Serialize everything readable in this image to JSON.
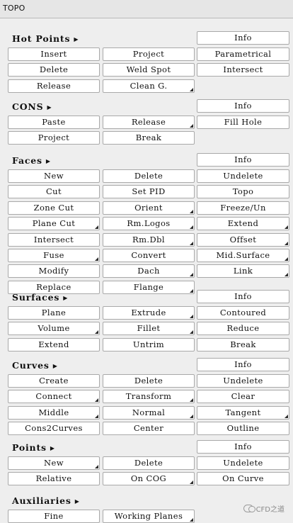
{
  "window": {
    "title": "TOPO"
  },
  "watermark": "CFD之道",
  "sections": [
    {
      "id": "hot-points",
      "title": "Hot Points",
      "info": "Info",
      "rows": [
        [
          "Insert",
          "Project",
          "Parametrical"
        ],
        [
          "Delete",
          "Weld Spot",
          "Intersect"
        ],
        [
          "Release",
          "Clean G."
        ]
      ],
      "corners": [
        "Clean G."
      ]
    },
    {
      "id": "cons",
      "title": "CONS",
      "info": "Info",
      "rows": [
        [
          "Paste",
          "Release",
          "Fill Hole"
        ],
        [
          "Project",
          "Break"
        ]
      ],
      "corners": [
        "Release"
      ]
    },
    {
      "id": "faces",
      "title": "Faces",
      "info": "Info",
      "rows": [
        [
          "New",
          "Delete",
          "Undelete"
        ],
        [
          "Cut",
          "Set PID",
          "Topo"
        ],
        [
          "Zone Cut",
          "Orient",
          "Freeze/Un"
        ],
        [
          "Plane Cut",
          "Rm.Logos",
          "Extend"
        ],
        [
          "Intersect",
          "Rm.Dbl",
          "Offset"
        ],
        [
          "Fuse",
          "Convert",
          "Mid.Surface"
        ],
        [
          "Modify",
          "Dach",
          "Link"
        ],
        [
          "Replace",
          "Flange"
        ]
      ],
      "corners": [
        "Orient",
        "Plane Cut",
        "Rm.Logos",
        "Extend",
        "Rm.Dbl",
        "Offset",
        "Fuse",
        "Mid.Surface",
        "Dach",
        "Link",
        "Flange"
      ]
    },
    {
      "id": "surfaces",
      "title": "Surfaces",
      "info": "Info",
      "rows": [
        [
          "Plane",
          "Extrude",
          "Contoured"
        ],
        [
          "Volume",
          "Fillet",
          "Reduce"
        ],
        [
          "Extend",
          "Untrim",
          "Break"
        ]
      ],
      "corners": [
        "Extrude",
        "Volume",
        "Fillet"
      ]
    },
    {
      "id": "curves",
      "title": "Curves",
      "info": "Info",
      "rows": [
        [
          "Create",
          "Delete",
          "Undelete"
        ],
        [
          "Connect",
          "Transform",
          "Clear"
        ],
        [
          "Middle",
          "Normal",
          "Tangent"
        ],
        [
          "Cons2Curves",
          "Center",
          "Outline"
        ]
      ],
      "corners": [
        "Connect",
        "Transform",
        "Middle",
        "Normal",
        "Tangent"
      ]
    },
    {
      "id": "points",
      "title": "Points",
      "info": "Info",
      "rows": [
        [
          "New",
          "Delete",
          "Undelete"
        ],
        [
          "Relative",
          "On COG",
          "On Curve"
        ]
      ],
      "corners": [
        "New",
        "On COG"
      ]
    },
    {
      "id": "auxiliaries",
      "title": "Auxiliaries",
      "info": null,
      "rows": [
        [
          "Fine",
          "Working Planes"
        ]
      ],
      "corners": [
        "Working Planes"
      ]
    }
  ]
}
